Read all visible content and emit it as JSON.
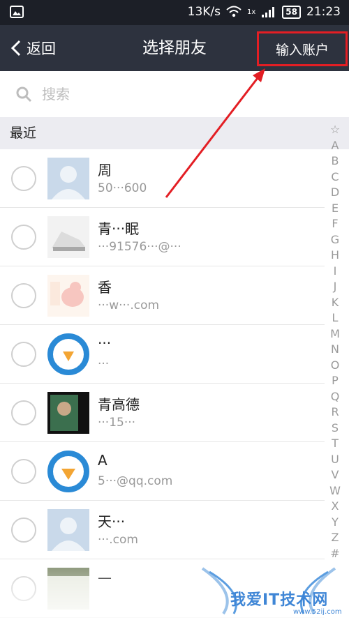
{
  "status_bar": {
    "network_speed": "13K/s",
    "battery_level": "58",
    "time": "21:23",
    "signal_label": "1x"
  },
  "nav": {
    "back_label": "返回",
    "title": "选择朋友",
    "account_label": "输入账户"
  },
  "search": {
    "placeholder": "搜索"
  },
  "section": {
    "label": "最近"
  },
  "friends": [
    {
      "name": "周",
      "detail": "50···600"
    },
    {
      "name": "青···眠",
      "detail": "···91576···@···"
    },
    {
      "name": "香",
      "detail": "···w···.com"
    },
    {
      "name": "···",
      "detail": "···"
    },
    {
      "name": "青高德",
      "detail": "···15···"
    },
    {
      "name": "A",
      "detail": "5···@qq.com"
    },
    {
      "name": "天···",
      "detail": "···.com"
    },
    {
      "name": "—",
      "detail": ""
    }
  ],
  "index_letters": [
    "☆",
    "A",
    "B",
    "C",
    "D",
    "E",
    "F",
    "G",
    "H",
    "I",
    "J",
    "K",
    "L",
    "M",
    "N",
    "O",
    "P",
    "Q",
    "R",
    "S",
    "T",
    "U",
    "V",
    "W",
    "X",
    "Y",
    "Z",
    "#"
  ],
  "watermark": {
    "text": "我爱IT技术网",
    "url": "www.52ij.com"
  },
  "colors": {
    "nav_bg": "#2d323e",
    "highlight": "#e31e24",
    "section_bg": "#ececf1"
  }
}
